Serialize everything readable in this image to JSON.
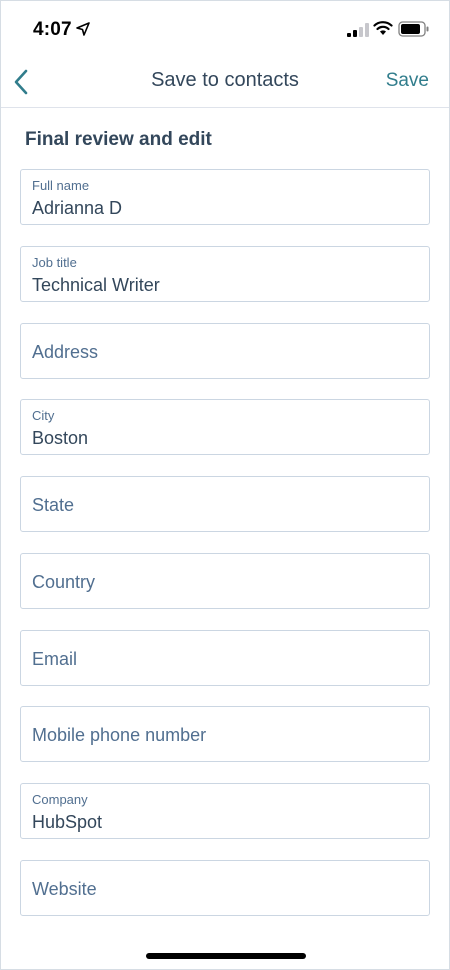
{
  "status_bar": {
    "time": "4:07"
  },
  "nav": {
    "title": "Save to contacts",
    "save_label": "Save"
  },
  "section": {
    "heading": "Final review and edit"
  },
  "fields": {
    "full_name": {
      "label": "Full name",
      "value": "Adrianna D"
    },
    "job_title": {
      "label": "Job title",
      "value": "Technical Writer"
    },
    "address": {
      "placeholder": "Address"
    },
    "city": {
      "label": "City",
      "value": "Boston"
    },
    "state": {
      "placeholder": "State"
    },
    "country": {
      "placeholder": "Country"
    },
    "email": {
      "placeholder": "Email"
    },
    "mobile_phone": {
      "placeholder": "Mobile phone number"
    },
    "company": {
      "label": "Company",
      "value": "HubSpot"
    },
    "website": {
      "placeholder": "Website"
    }
  },
  "colors": {
    "accent": "#317d8c",
    "text": "#33475b",
    "label": "#516f90",
    "border": "#cbd6e2"
  }
}
